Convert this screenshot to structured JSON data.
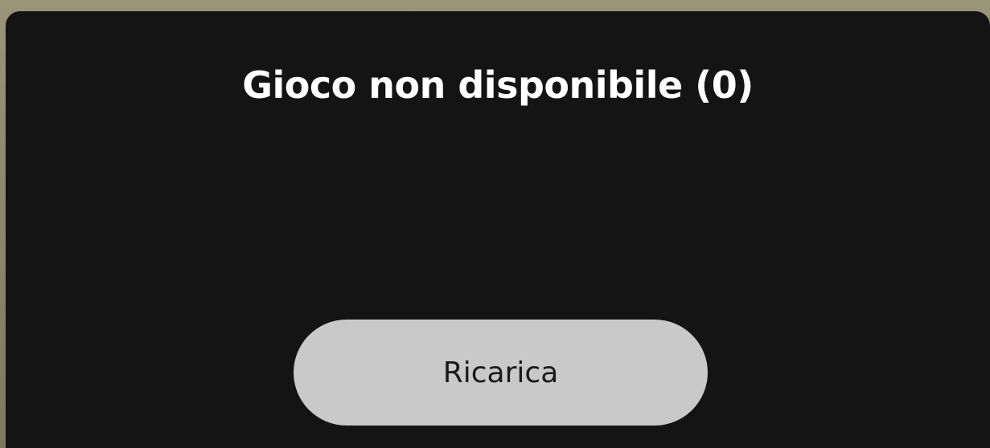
{
  "dialog": {
    "title": "Gioco non disponibile (0)",
    "reload_label": "Ricarica"
  },
  "colors": {
    "dialog_background": "#141414",
    "button_background": "#c9c9c9",
    "title_text": "#ffffff",
    "button_text": "#1a1a1a"
  }
}
